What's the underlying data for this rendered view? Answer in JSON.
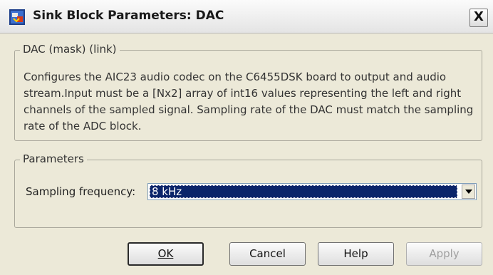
{
  "window": {
    "title": "Sink Block Parameters: DAC",
    "close_glyph": "X",
    "icon": "simulink-block-icon"
  },
  "description": {
    "group_label": "DAC (mask) (link)",
    "text": "Configures the AIC23 audio codec on the C6455DSK board to output and audio stream.Input must be a [Nx2] array of int16 values representing the left and right channels of the sampled signal. Sampling rate of the DAC must match the sampling rate of the ADC block."
  },
  "parameters": {
    "group_label": "Parameters",
    "sampling_label": "Sampling frequency:",
    "sampling_value": "8 kHz"
  },
  "buttons": {
    "ok": "OK",
    "cancel": "Cancel",
    "help": "Help",
    "apply": "Apply"
  },
  "colors": {
    "selection": "#0a246a",
    "window_bg": "#ece9d8"
  }
}
